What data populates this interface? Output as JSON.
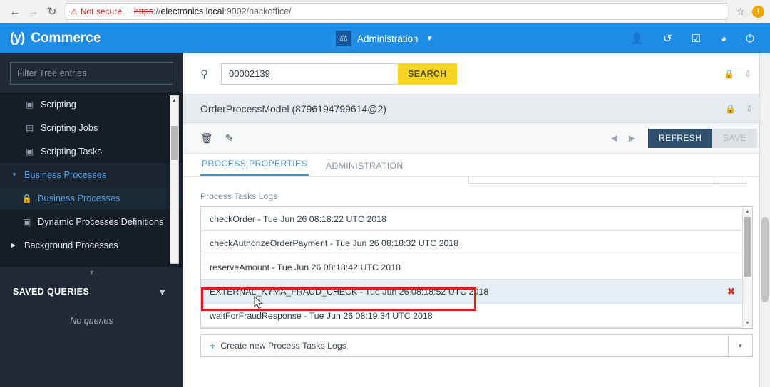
{
  "browser": {
    "back_icon": "back-arrow-icon",
    "forward_icon": "forward-arrow-icon",
    "reload_icon": "reload-icon",
    "security_label": "Not secure",
    "warning_glyph": "⚠",
    "url_scheme": "https",
    "url_separator": "://",
    "url_host": "electronics.local",
    "url_path": ":9002/backoffice/",
    "bookmark_icon": "star-icon",
    "profile_badge": "!"
  },
  "topbar": {
    "logo_mark": "(y)",
    "logo_text": "Commerce",
    "admin_icon": "administration-icon",
    "admin_label": "Administration",
    "caret": "▼",
    "icons": [
      {
        "name": "user-icon",
        "glyph": "👤"
      },
      {
        "name": "history-icon",
        "glyph": "↺"
      },
      {
        "name": "checkbox-icon",
        "glyph": "☑"
      },
      {
        "name": "globe-icon",
        "glyph": "◕"
      },
      {
        "name": "power-icon",
        "glyph": "⏻"
      }
    ]
  },
  "sidebar": {
    "filter_placeholder": "Filter Tree entries",
    "tree": [
      {
        "label": "Scripting",
        "icon": "script-icon",
        "level": 0,
        "twisty": "",
        "state": "normal"
      },
      {
        "label": "Scripting Jobs",
        "icon": "script-job-icon",
        "level": 0,
        "twisty": "",
        "state": "normal"
      },
      {
        "label": "Scripting Tasks",
        "icon": "script-task-icon",
        "level": 0,
        "twisty": "",
        "state": "normal"
      },
      {
        "label": "Business Processes",
        "icon": "",
        "level": 0,
        "twisty": "▼",
        "state": "group-active"
      },
      {
        "label": "Business Processes",
        "icon": "lock-icon",
        "level": 1,
        "twisty": "",
        "state": "selected"
      },
      {
        "label": "Dynamic Processes Definitions",
        "icon": "dynamic-process-icon",
        "level": 1,
        "twisty": "",
        "state": "normal"
      },
      {
        "label": "Background Processes",
        "icon": "",
        "level": 0,
        "twisty": "▶",
        "state": "normal"
      }
    ],
    "saved_queries_title": "SAVED QUERIES",
    "filter_icon": "funnel-icon",
    "no_queries": "No queries"
  },
  "search": {
    "icon": "search-add-icon",
    "value": "00002139",
    "button_label": "SEARCH",
    "lock_icon": "lock-icon",
    "collapse_icon": "double-chevron-down-icon"
  },
  "panel": {
    "title": "OrderProcessModel (8796194799614@2)",
    "lock_icon": "lock-icon",
    "collapse_icon": "double-chevron-down-icon"
  },
  "toolbar": {
    "delete_icon": "trash-icon",
    "edit_icon": "edit-pencil-icon",
    "prev_icon": "◀",
    "next_icon": "▶",
    "refresh_label": "REFRESH",
    "save_label": "SAVE"
  },
  "tabs": [
    {
      "label": "PROCESS PROPERTIES",
      "active": true
    },
    {
      "label": "ADMINISTRATION",
      "active": false
    }
  ],
  "content": {
    "section_label": "Process Tasks Logs",
    "logs": [
      {
        "text": "checkOrder - Tue Jun 26 08:18:22 UTC 2018",
        "selected": false,
        "deletable": false
      },
      {
        "text": "checkAuthorizeOrderPayment - Tue Jun 26 08:18:32 UTC 2018",
        "selected": false,
        "deletable": false
      },
      {
        "text": "reserveAmount - Tue Jun 26 08:18:42 UTC 2018",
        "selected": false,
        "deletable": false
      },
      {
        "text": "EXTERNAL_KYMA_FRAUD_CHECK - Tue Jun 26 08:18:52 UTC 2018",
        "selected": true,
        "deletable": true
      },
      {
        "text": "waitForFraudResponse - Tue Jun 26 08:19:34 UTC 2018",
        "selected": false,
        "deletable": false
      }
    ],
    "delete_glyph": "✖",
    "create_label": "Create new Process Tasks Logs",
    "create_plus": "+",
    "create_caret": "▼"
  },
  "colors": {
    "brand_blue": "#1f8ce6",
    "sidebar_dark": "#1f2a36",
    "search_yellow": "#f5d423",
    "refresh_navy": "#2e4f6e",
    "annotation_red": "#e01b1b",
    "accent_link": "#4a9fe8"
  }
}
